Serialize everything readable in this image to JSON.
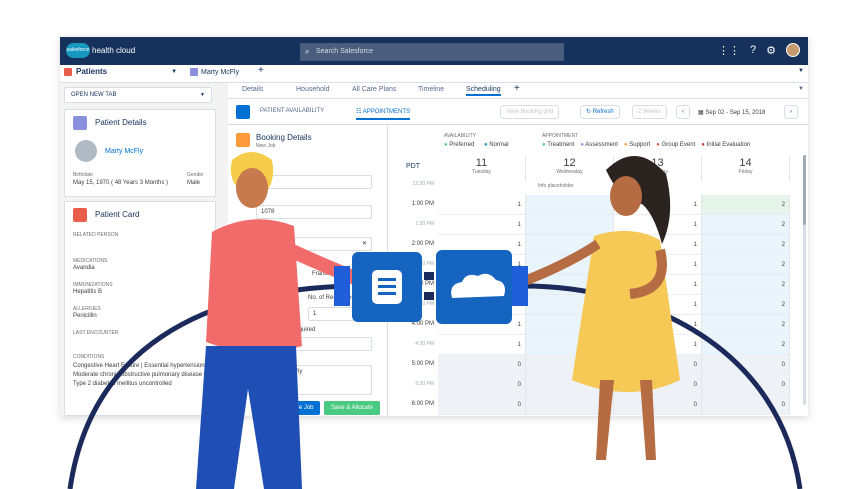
{
  "app": {
    "brand": "health cloud",
    "logo": "salesforce",
    "search_placeholder": "Search Salesforce",
    "icons": [
      "apps-grid-icon",
      "help-icon",
      "settings-gear-icon",
      "user-avatar"
    ]
  },
  "workspace": {
    "nav_label": "Patients",
    "tab_label": "Marty McFly",
    "open_new_tab": "OPEN NEW TAB"
  },
  "subtabs": [
    "Details",
    "Household",
    "All Care Plans",
    "Timeline",
    "Scheduling"
  ],
  "patient": {
    "title": "Patient Details",
    "name": "Marty McFly",
    "birthdate_label": "Birthdate",
    "birthdate": "May 15, 1970 ( 48 Years 3 Months )",
    "gender_label": "Gender",
    "gender": "Male",
    "card_title": "Patient Card",
    "related_label": "RELATED PERSON",
    "medications_label": "MEDICATIONS",
    "medications": "Avandia",
    "immunizations_label": "IMMUNIZATIONS",
    "immunizations": "Hepatitis B",
    "allergies_label": "ALLERGIES",
    "allergies": "Penicillin",
    "last_encounter_label": "LAST ENCOUNTER",
    "conditions_label": "CONDITIONS",
    "conditions": "Congestive Heart Failure | Essential hypertension | Moderate chronic obstructive pulmonary disease | Type 2 diabetes mellitus uncontrolled"
  },
  "scheduling": {
    "tab_availability": "PATIENT AVAILABILITY",
    "tab_appointments": "APPOINTMENTS",
    "view_booking": "View booking grid",
    "refresh": "Refresh",
    "weeks": "2 Weeks",
    "date_range": "Sep 02 - Sep 15, 2018",
    "booking_title": "Booking Details",
    "booking_sub": "New Job",
    "field_a": "ent",
    "field_b": "1078",
    "field_location": "Francisco, CA",
    "label_from": "m",
    "label_resources": "No. of Resources",
    "resources_value": "1",
    "label_minutes": "utes Required",
    "notes": "for Marty McFly",
    "save_job": "Save Job",
    "save_allocate": "Save & Allocate",
    "cancel": "C"
  },
  "calendar": {
    "availability_label": "AVAILABILITY",
    "preferred": "Preferred",
    "normal": "Normal",
    "appointment_label": "APPOINTMENT",
    "types": [
      "Treatment",
      "Assessment",
      "Support",
      "Group Event",
      "Initial Evaluation"
    ],
    "type_colors": [
      "#4bca81",
      "#8a8fde",
      "#ff9a3c",
      "#e85c4a",
      "#c23934"
    ],
    "timezone": "PDT",
    "days": [
      {
        "num": "11",
        "name": "Tuesday"
      },
      {
        "num": "12",
        "name": "Wednesday"
      },
      {
        "num": "13",
        "name": "Thursday"
      },
      {
        "num": "14",
        "name": "Friday"
      }
    ],
    "info": "Info placeholder",
    "times": [
      "12:30 PM",
      "1:00 PM",
      "1:30 PM",
      "2:00 PM",
      "2:30 PM",
      "3:00 PM",
      "3:30 PM",
      "4:00 PM",
      "4:30 PM",
      "5:00 PM",
      "5:30 PM",
      "6:00 PM"
    ],
    "rows": [
      [
        "1",
        "",
        "1",
        "2"
      ],
      [
        "1",
        "",
        "1",
        "2"
      ],
      [
        "1",
        "",
        "1",
        "2"
      ],
      [
        "1",
        "",
        "1",
        "2"
      ],
      [
        "1",
        "",
        "1",
        "2"
      ],
      [
        "1",
        "",
        "1",
        "2"
      ],
      [
        "1",
        "",
        "1",
        "2"
      ],
      [
        "1",
        "",
        "1",
        "2"
      ],
      [
        "0",
        "",
        "0",
        "0"
      ],
      [
        "0",
        "",
        "0",
        "0"
      ],
      [
        "0",
        "",
        "0",
        "0"
      ]
    ]
  }
}
